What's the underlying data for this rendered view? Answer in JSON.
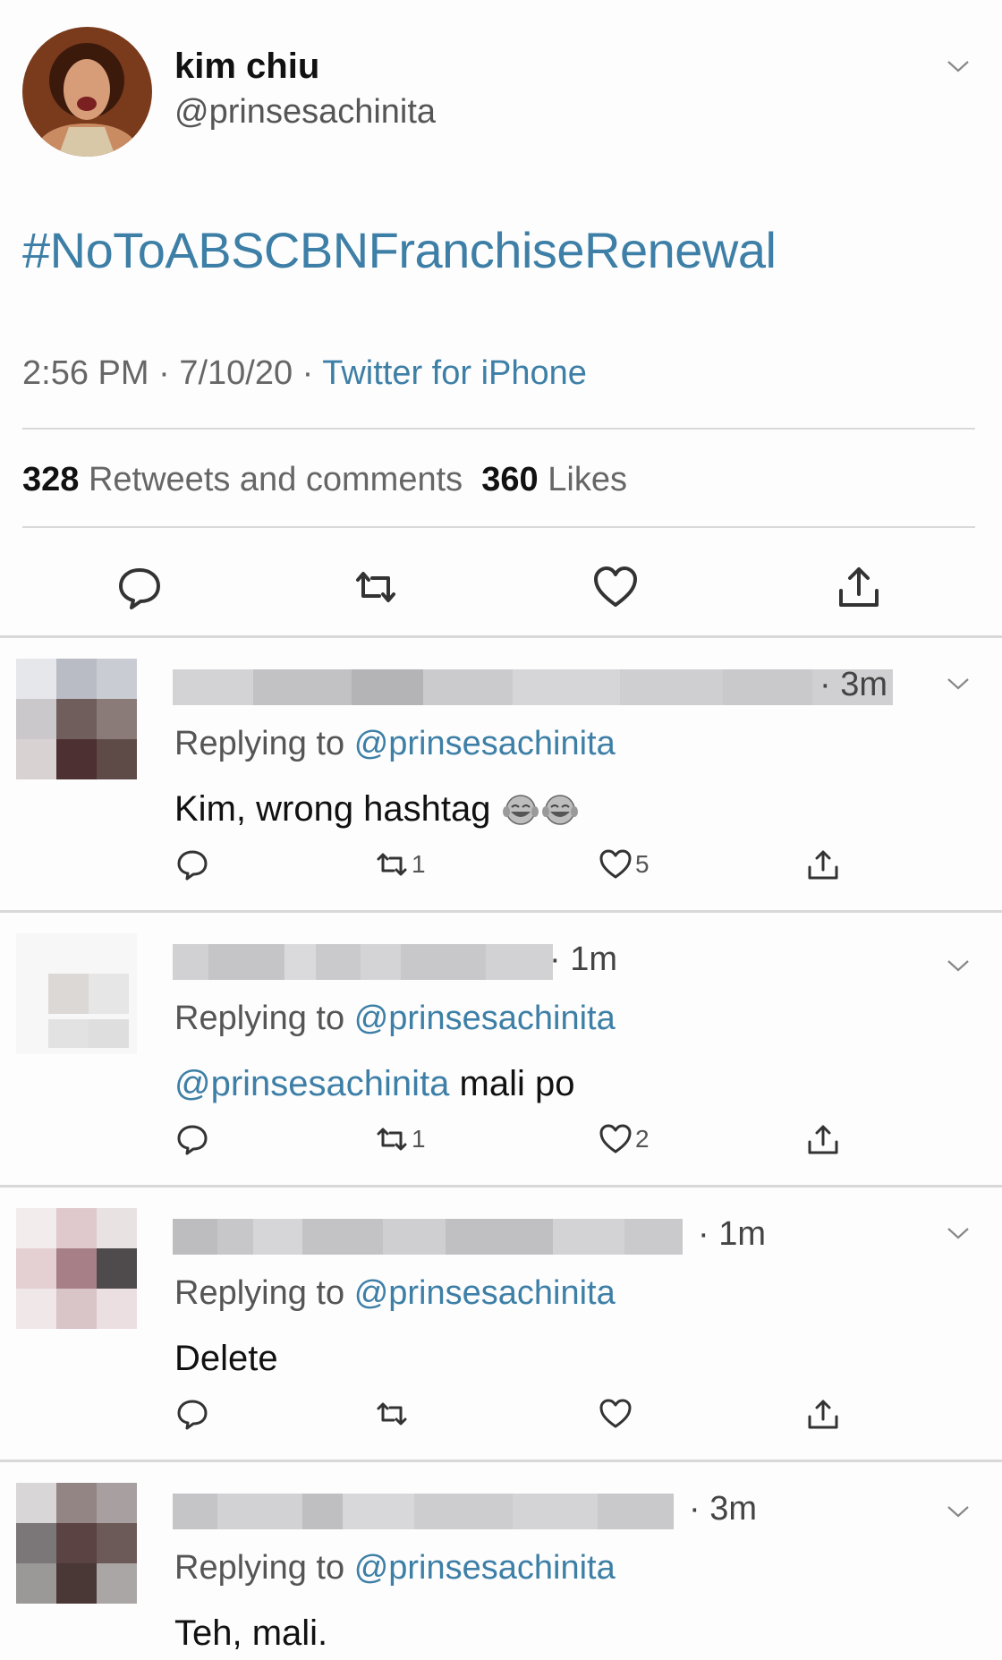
{
  "tweet": {
    "display_name": "kim chiu",
    "handle": "@prinsesachinita",
    "hashtag": "#NoToABSCBNFranchiseRenewal",
    "time": "2:56 PM",
    "date": "7/10/20",
    "source": "Twitter for iPhone",
    "retweets_count": "328",
    "retweets_label": "Retweets and comments",
    "likes_count": "360",
    "likes_label": "Likes",
    "icons": [
      "reply-icon",
      "retweet-icon",
      "like-icon",
      "share-icon"
    ]
  },
  "replies": [
    {
      "time": "3m",
      "replying_prefix": "Replying to",
      "replying_handle": "@prinsesachinita",
      "text": "Kim, wrong hashtag",
      "emoji": "😂😂",
      "retweets": "1",
      "likes": "5"
    },
    {
      "time": "1m",
      "replying_prefix": "Replying to",
      "replying_handle": "@prinsesachinita",
      "mention": "@prinsesachinita",
      "text": "mali po",
      "retweets": "1",
      "likes": "2"
    },
    {
      "time": "1m",
      "replying_prefix": "Replying to",
      "replying_handle": "@prinsesachinita",
      "text": "Delete",
      "retweets": "",
      "likes": ""
    },
    {
      "time": "3m",
      "replying_prefix": "Replying to",
      "replying_handle": "@prinsesachinita",
      "text": "Teh, mali."
    }
  ],
  "colors": {
    "link": "#3d7fa6",
    "divider": "#d8d8d8",
    "background": "#fdfdfd"
  }
}
